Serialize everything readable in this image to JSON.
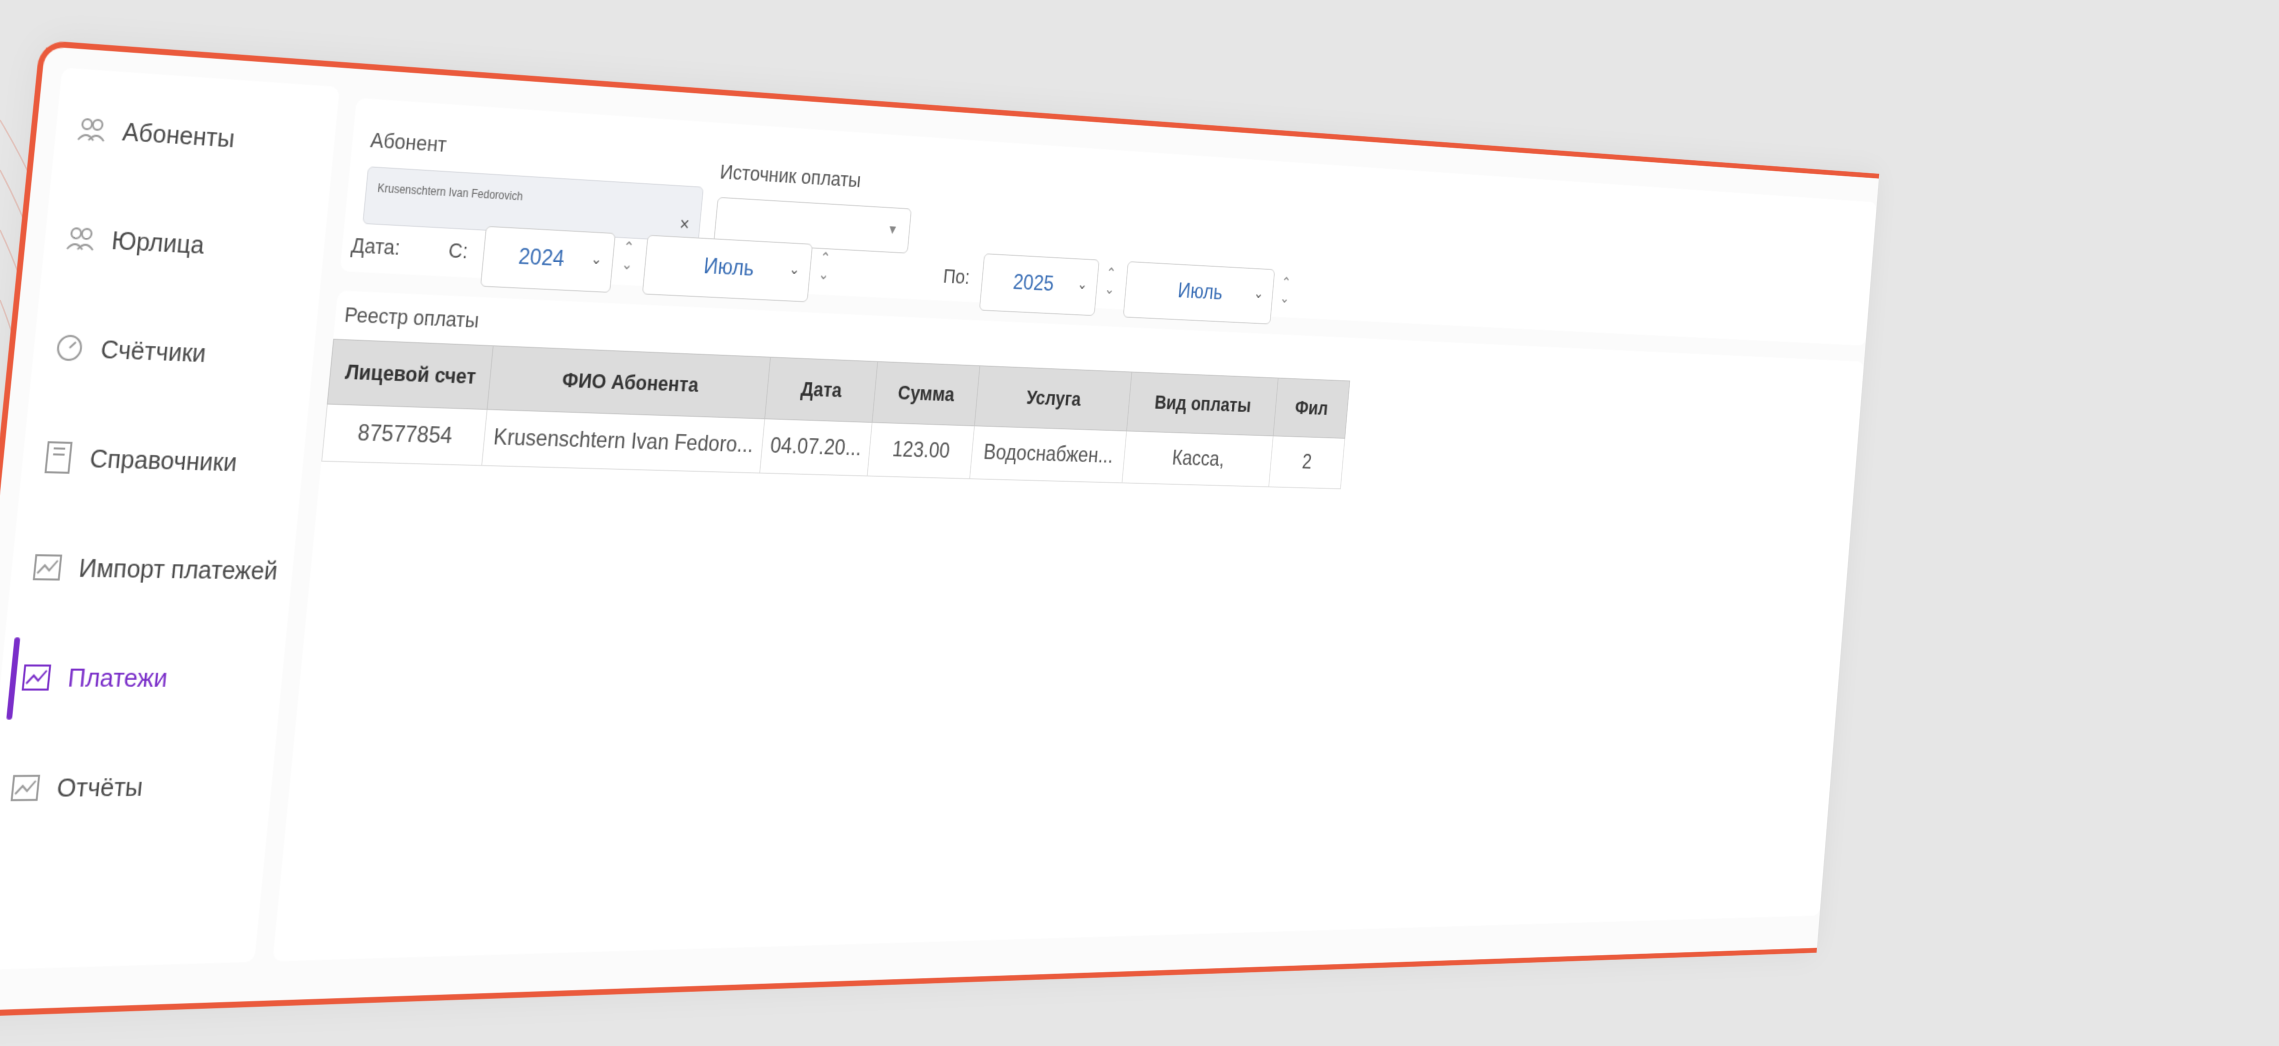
{
  "sidebar": {
    "items": [
      {
        "label": "Абоненты",
        "icon": "users-icon"
      },
      {
        "label": "Юрлица",
        "icon": "users-icon"
      },
      {
        "label": "Счётчики",
        "icon": "meter-icon"
      },
      {
        "label": "Справочники",
        "icon": "book-icon"
      },
      {
        "label": "Импорт платежей",
        "icon": "chart-icon"
      },
      {
        "label": "Платежи",
        "icon": "chart-icon",
        "active": true
      },
      {
        "label": "Отчёты",
        "icon": "chart-icon"
      }
    ]
  },
  "filters": {
    "abonent_label": "Абонент",
    "abonent_value": "Krusenschtern Ivan Fedorovich",
    "source_label": "Источник оплаты",
    "source_value": "",
    "date_label": "Дата:",
    "from_label": "С:",
    "from_year": "2024",
    "from_month": "Июль",
    "to_label": "По:",
    "to_year": "2025",
    "to_month": "Июль"
  },
  "registry": {
    "title": "Реестр оплаты",
    "columns": [
      "Лицевой счет",
      "ФИО Абонента",
      "Дата",
      "Сумма",
      "Услуга",
      "Вид оплаты",
      "Фил"
    ],
    "rows": [
      [
        "87577854",
        "Krusenschtern Ivan Fedoro...",
        "04.07.20...",
        "123.00",
        "Водоснабжен...",
        "Касса,",
        "2"
      ]
    ]
  },
  "colors": {
    "accent": "#7a2ec9",
    "frame": "#ea5a3c"
  }
}
